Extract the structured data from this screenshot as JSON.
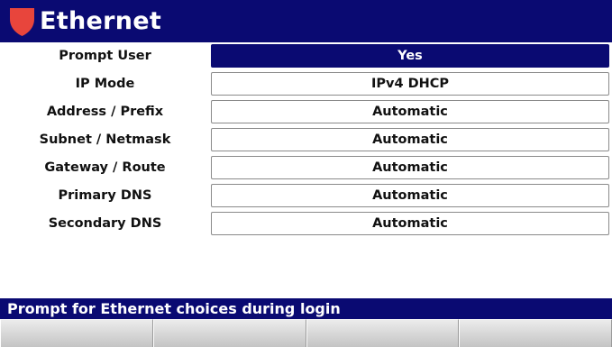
{
  "header": {
    "title": "Ethernet",
    "icon": "shield-icon",
    "icon_color": "#e8453c",
    "bar_color": "#0a0a72"
  },
  "settings": [
    {
      "label": "Prompt User",
      "value": "Yes",
      "selected": true
    },
    {
      "label": "IP Mode",
      "value": "IPv4 DHCP",
      "selected": false
    },
    {
      "label": "Address / Prefix",
      "value": "Automatic",
      "selected": false
    },
    {
      "label": "Subnet / Netmask",
      "value": "Automatic",
      "selected": false
    },
    {
      "label": "Gateway / Route",
      "value": "Automatic",
      "selected": false
    },
    {
      "label": "Primary DNS",
      "value": "Automatic",
      "selected": false
    },
    {
      "label": "Secondary DNS",
      "value": "Automatic",
      "selected": false
    }
  ],
  "status": {
    "message": "Prompt for Ethernet choices during login"
  },
  "softkeys": [
    {
      "label": ""
    },
    {
      "label": ""
    },
    {
      "label": ""
    },
    {
      "label": ""
    }
  ]
}
